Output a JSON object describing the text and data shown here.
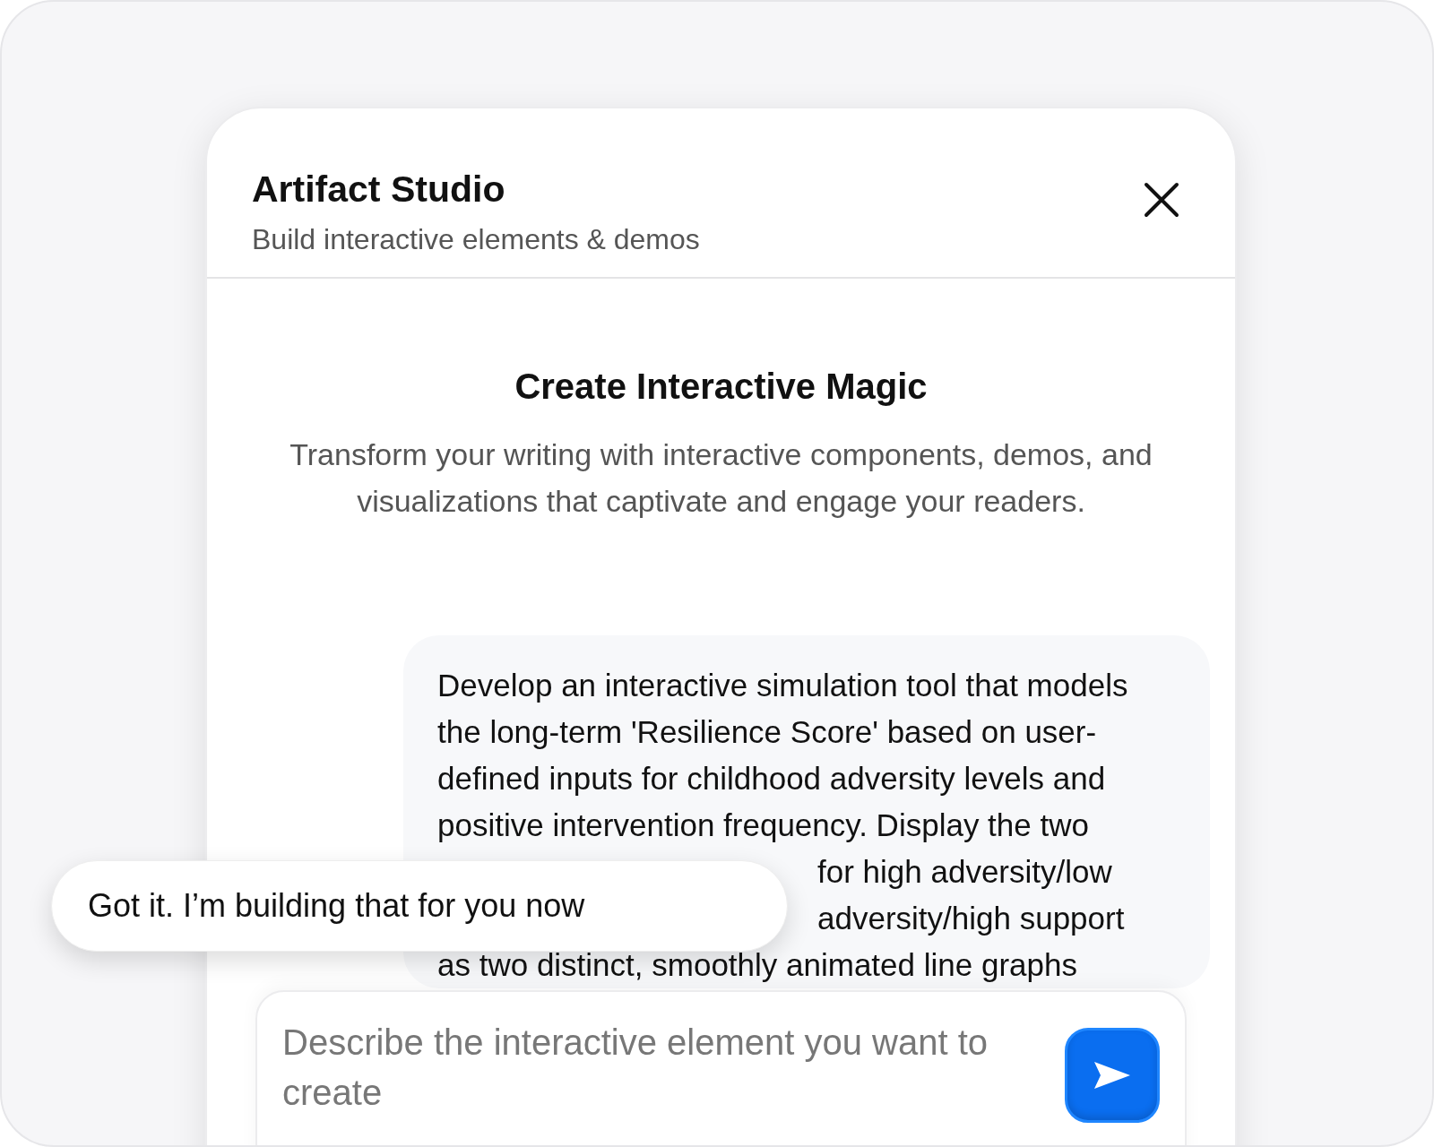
{
  "header": {
    "title": "Artifact Studio",
    "subtitle": "Build interactive elements & demos"
  },
  "intro": {
    "heading": "Create Interactive Magic",
    "text": "Transform your writing with interactive components, demos, and visualizations that captivate and engage your readers."
  },
  "message": {
    "lines": [
      {
        "kind": "full",
        "text": "Develop an interactive simulation tool that models"
      },
      {
        "kind": "full",
        "text": "the long-term 'Resilience Score' based on user-"
      },
      {
        "kind": "full",
        "text": "defined inputs for childhood adversity levels and"
      },
      {
        "kind": "full",
        "text": "positive intervention frequency. Display the two"
      },
      {
        "kind": "partial",
        "text": "for high adversity/low"
      },
      {
        "kind": "partial",
        "text": "adversity/high support"
      },
      {
        "kind": "full",
        "text": "as two distinct, smoothly animated line graphs"
      }
    ]
  },
  "toast": {
    "text": "Got it. I’m building that for you now"
  },
  "composer": {
    "placeholder": "Describe the interactive element you want to create"
  }
}
